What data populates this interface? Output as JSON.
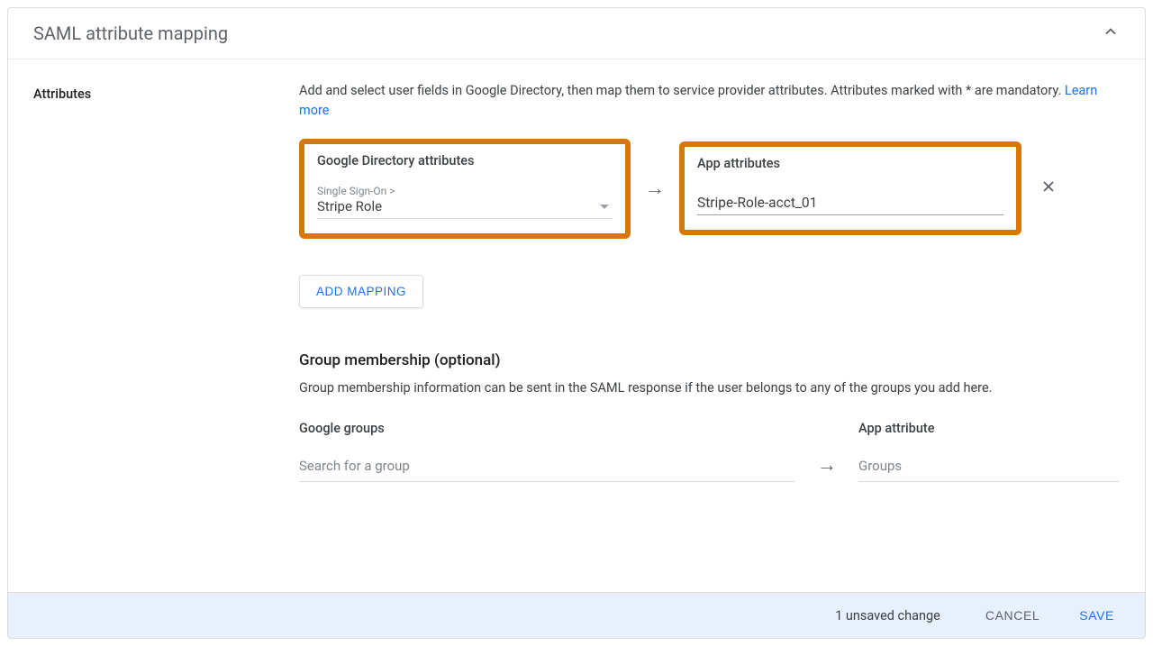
{
  "header": {
    "title": "SAML attribute mapping"
  },
  "left": {
    "section_label": "Attributes"
  },
  "description": {
    "text": "Add and select user fields in Google Directory, then map them to service provider attributes. Attributes marked with * are mandatory. ",
    "learn_more": "Learn more"
  },
  "mapping": {
    "dir_label": "Google Directory attributes",
    "app_label": "App attributes",
    "select_super": "Single Sign-On >",
    "select_value": "Stripe Role",
    "app_value": "Stripe-Role-acct_01"
  },
  "add_mapping_label": "ADD MAPPING",
  "group_section": {
    "title": "Group membership (optional)",
    "desc": "Group membership information can be sent in the SAML response if the user belongs to any of the groups you add here.",
    "google_groups_label": "Google groups",
    "search_placeholder": "Search for a group",
    "app_attribute_label": "App attribute",
    "app_attr_placeholder": "Groups"
  },
  "footer": {
    "unsaved": "1 unsaved change",
    "cancel": "CANCEL",
    "save": "SAVE"
  }
}
